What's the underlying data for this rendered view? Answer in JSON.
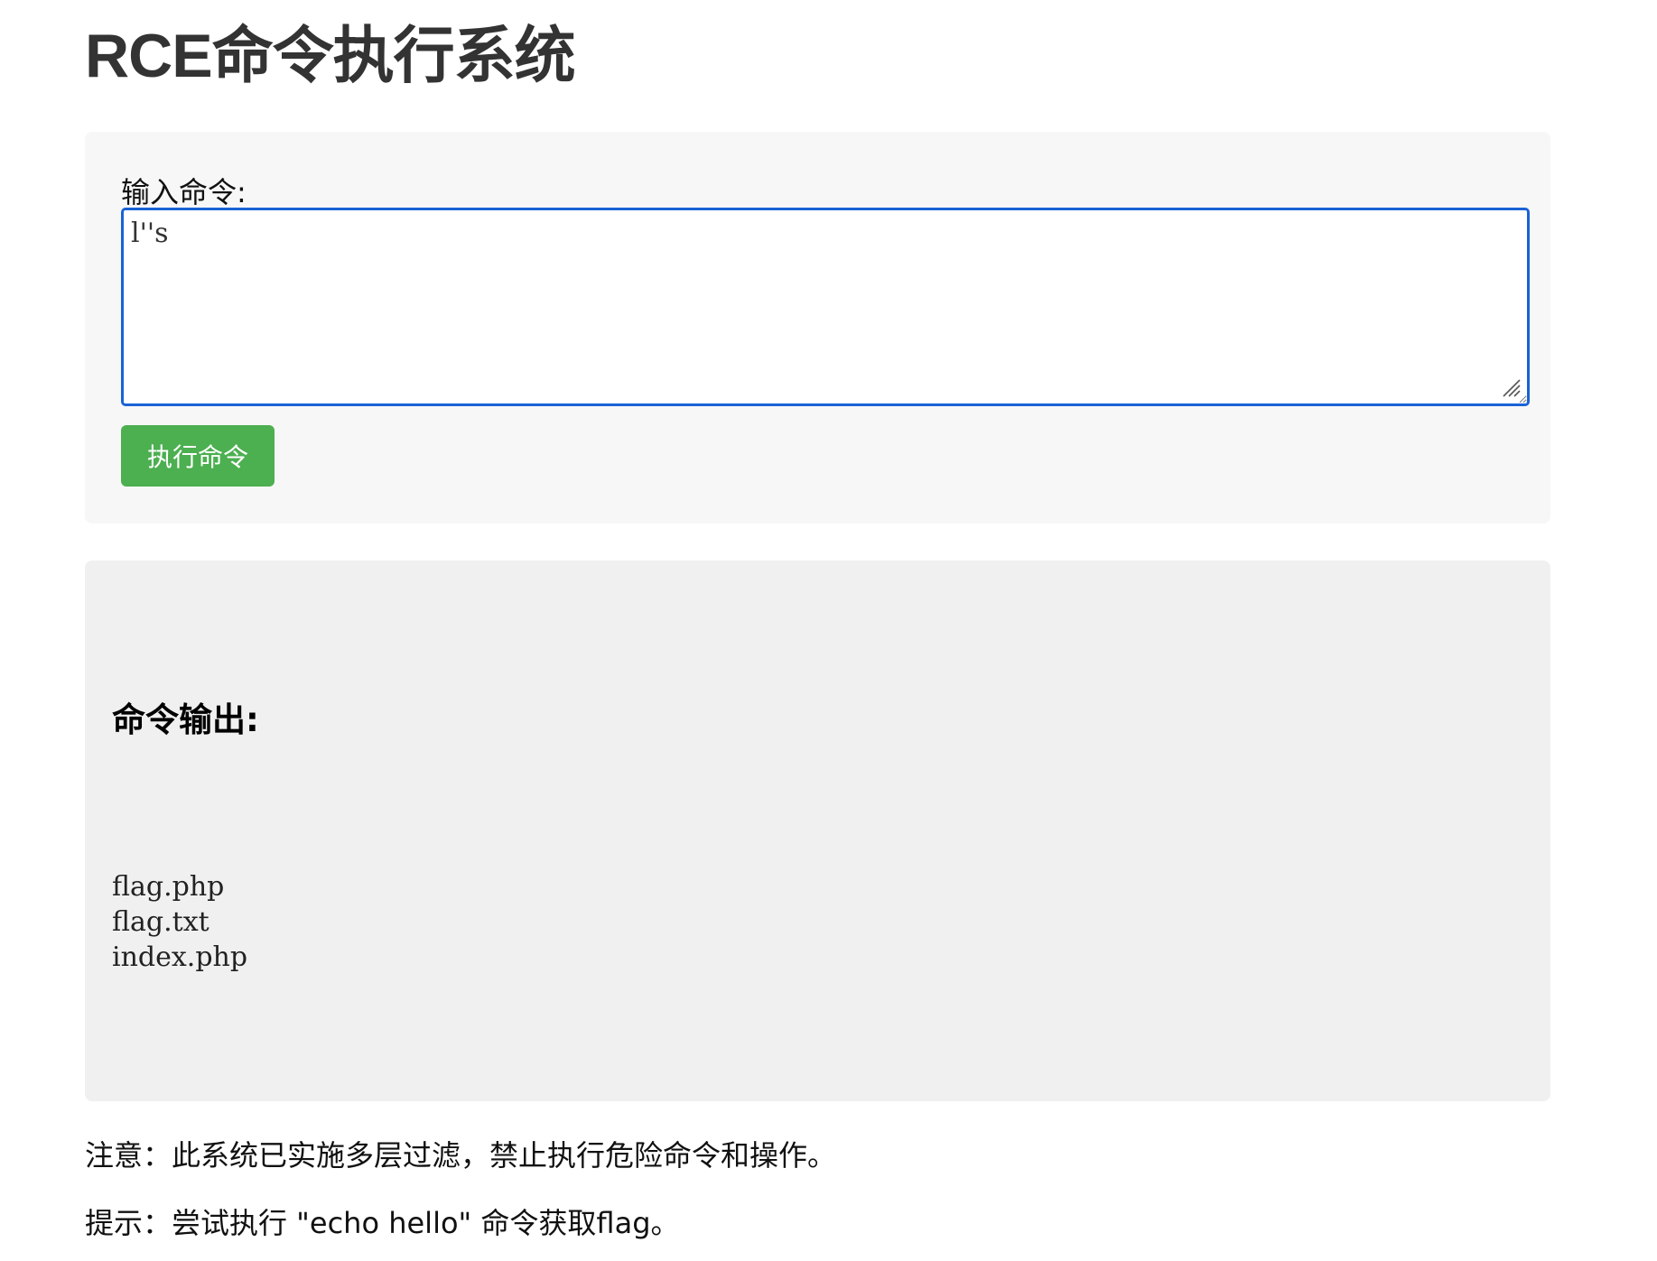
{
  "page": {
    "title": "RCE命令执行系统"
  },
  "form": {
    "label": "输入命令:",
    "input_value": "l''s",
    "button_label": "执行命令"
  },
  "output": {
    "heading": "命令输出:",
    "lines": "flag.php\nflag.txt\nindex.php"
  },
  "notes": {
    "warning": "注意：此系统已实施多层过滤，禁止执行危险命令和操作。",
    "hint": "提示：尝试执行 \"echo hello\" 命令获取flag。"
  },
  "colors": {
    "button_bg": "#4caf50",
    "input_focus_border": "#1a62d6",
    "form_panel_bg": "#f7f7f7",
    "output_panel_bg": "#f0f0f0"
  },
  "icons": {
    "resize_handle": "resize-grip-icon"
  }
}
